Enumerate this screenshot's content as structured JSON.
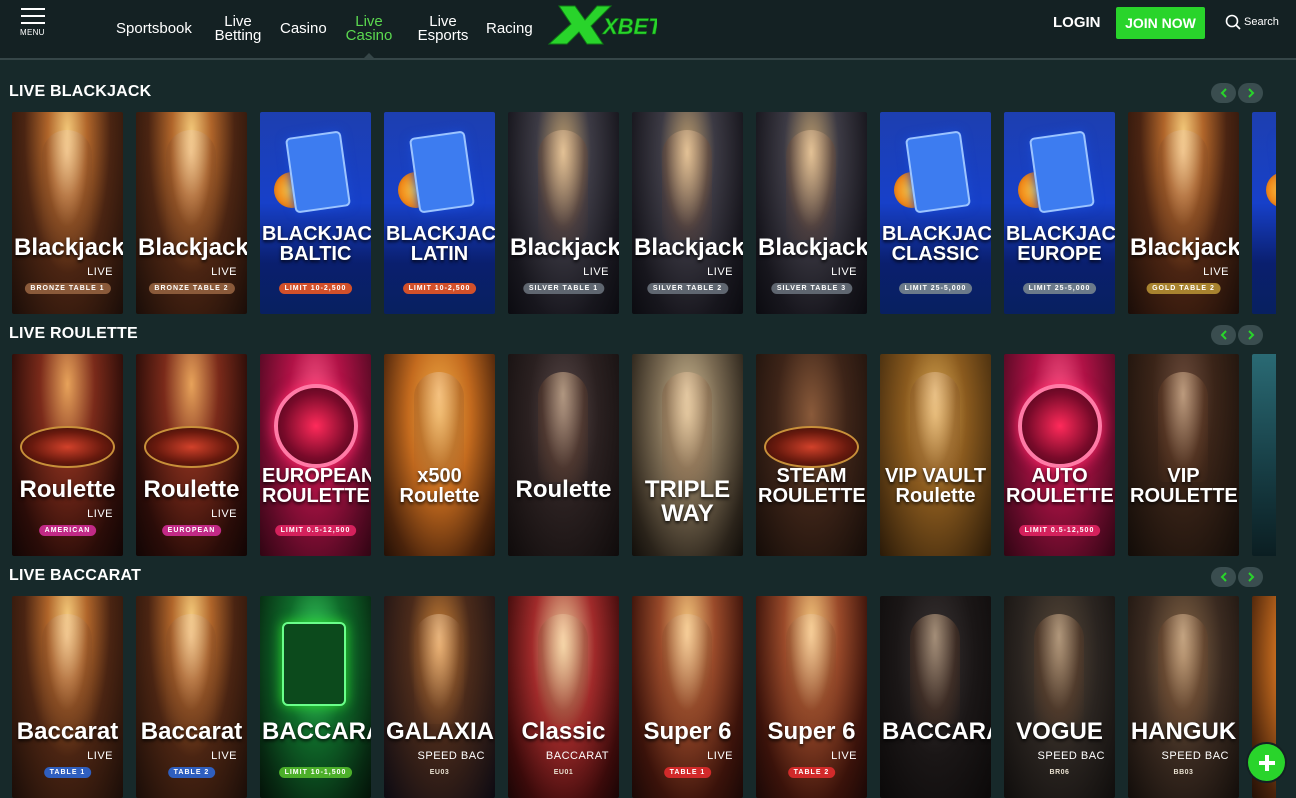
{
  "header": {
    "menu_label": "MENU",
    "nav": [
      {
        "line1": "Sportsbook"
      },
      {
        "line1": "Live",
        "line2": "Betting"
      },
      {
        "line1": "Casino"
      },
      {
        "line1": "Live",
        "line2": "Casino",
        "active": true
      },
      {
        "line1": "Live",
        "line2": "Esports"
      },
      {
        "line1": "Racing"
      }
    ],
    "logo_text": "XBET",
    "login_label": "LOGIN",
    "join_label": "JOIN NOW",
    "search_label": "Search",
    "accent_color": "#29d42b"
  },
  "sections": [
    {
      "title": "LIVE BLACKJACK",
      "cards": [
        {
          "title": "Blackjack",
          "sub": "LIVE",
          "badge": "BRONZE TABLE 1",
          "theme": "gold-room",
          "badge_color": "#8a5a3a"
        },
        {
          "title": "Blackjack",
          "sub": "LIVE",
          "badge": "BRONZE TABLE 2",
          "theme": "gold-room",
          "badge_color": "#8a5a3a"
        },
        {
          "title": "BLACKJACK BALTIC",
          "sub": "",
          "badge": "LIMIT 10-2,500",
          "theme": "blue-cards",
          "badge_color": "#d2502a"
        },
        {
          "title": "BLACKJACK LATIN",
          "sub": "",
          "badge": "LIMIT 10-2,500",
          "theme": "blue-cards",
          "badge_color": "#d2502a"
        },
        {
          "title": "Blackjack",
          "sub": "LIVE",
          "badge": "SILVER TABLE 1",
          "theme": "dark-room",
          "badge_color": "#5f6670"
        },
        {
          "title": "Blackjack",
          "sub": "LIVE",
          "badge": "SILVER TABLE 2",
          "theme": "dark-room",
          "badge_color": "#5f6670"
        },
        {
          "title": "Blackjack",
          "sub": "LIVE",
          "badge": "SILVER TABLE 3",
          "theme": "dark-room",
          "badge_color": "#5f6670"
        },
        {
          "title": "BLACKJACK CLASSIC",
          "sub": "",
          "badge": "LIMIT 25-5,000",
          "theme": "blue-cards",
          "badge_color": "#6b7a8a"
        },
        {
          "title": "BLACKJACK EUROPE",
          "sub": "",
          "badge": "LIMIT 25-5,000",
          "theme": "blue-cards",
          "badge_color": "#6b7a8a"
        },
        {
          "title": "Blackjack",
          "sub": "LIVE",
          "badge": "GOLD TABLE 2",
          "theme": "gold-room",
          "badge_color": "#a8832f"
        },
        {
          "title": "BL",
          "sub": "",
          "badge": "",
          "theme": "blue-cards",
          "badge_color": ""
        }
      ]
    },
    {
      "title": "LIVE ROULETTE",
      "cards": [
        {
          "title": "Roulette",
          "sub": "LIVE",
          "badge": "AMERICAN",
          "theme": "roulette-room",
          "badge_color": "#c12a86"
        },
        {
          "title": "Roulette",
          "sub": "LIVE",
          "badge": "EUROPEAN",
          "theme": "roulette-room",
          "badge_color": "#c12a86"
        },
        {
          "title": "EUROPEAN ROULETTE",
          "sub": "",
          "badge": "LIMIT 0.5-12,500",
          "theme": "pink-wheel",
          "badge_color": "#d4215c"
        },
        {
          "title": "x500 Roulette",
          "sub": "",
          "badge": "",
          "theme": "orange-dealer",
          "badge_color": ""
        },
        {
          "title": "Roulette",
          "sub": "",
          "badge": "",
          "theme": "dark-dealer",
          "badge_color": ""
        },
        {
          "title": "TRIPLE WAY",
          "sub": "",
          "badge": "",
          "theme": "gold-dealer",
          "badge_color": ""
        },
        {
          "title": "STEAM ROULETTE",
          "sub": "",
          "badge": "",
          "theme": "steam",
          "badge_color": ""
        },
        {
          "title": "VIP VAULT Roulette",
          "sub": "",
          "badge": "",
          "theme": "vault",
          "badge_color": ""
        },
        {
          "title": "AUTO ROULETTE",
          "sub": "",
          "badge": "LIMIT 0.5-12,500",
          "theme": "pink-wheel",
          "badge_color": "#d4215c"
        },
        {
          "title": "VIP ROULETTE",
          "sub": "",
          "badge": "",
          "theme": "vip",
          "badge_color": ""
        },
        {
          "title": "",
          "sub": "",
          "badge": "",
          "theme": "teal",
          "badge_color": ""
        }
      ]
    },
    {
      "title": "LIVE BACCARAT",
      "cards": [
        {
          "title": "Baccarat",
          "sub": "LIVE",
          "badge": "TABLE 1",
          "theme": "gold-room",
          "badge_color": "#2f5fbf"
        },
        {
          "title": "Baccarat",
          "sub": "LIVE",
          "badge": "TABLE 2",
          "theme": "gold-room",
          "badge_color": "#2f5fbf"
        },
        {
          "title": "BACCARAT",
          "sub": "",
          "badge": "LIMIT 10-1,500",
          "theme": "green-cards",
          "badge_color": "#4caf2a"
        },
        {
          "title": "GALAXIA",
          "sub": "SPEED BAC",
          "badge": "EU03",
          "theme": "galaxia",
          "badge_color": ""
        },
        {
          "title": "Classic",
          "sub": "BACCARAT",
          "badge": "EU01",
          "theme": "classic",
          "badge_color": ""
        },
        {
          "title": "Super 6",
          "sub": "LIVE",
          "badge": "TABLE 1",
          "theme": "red-room",
          "badge_color": "#d12a2a"
        },
        {
          "title": "Super 6",
          "sub": "LIVE",
          "badge": "TABLE 2",
          "theme": "red-room",
          "badge_color": "#d12a2a"
        },
        {
          "title": "BACCARAT",
          "sub": "",
          "badge": "",
          "theme": "dark-dealer2",
          "badge_color": ""
        },
        {
          "title": "VOGUE",
          "sub": "SPEED BAC",
          "badge": "BR06",
          "theme": "vogue",
          "badge_color": ""
        },
        {
          "title": "HANGUK",
          "sub": "SPEED BAC",
          "badge": "BB03",
          "theme": "hanguk",
          "badge_color": ""
        },
        {
          "title": "",
          "sub": "",
          "badge": "",
          "theme": "orange-dealer",
          "badge_color": ""
        }
      ]
    }
  ]
}
